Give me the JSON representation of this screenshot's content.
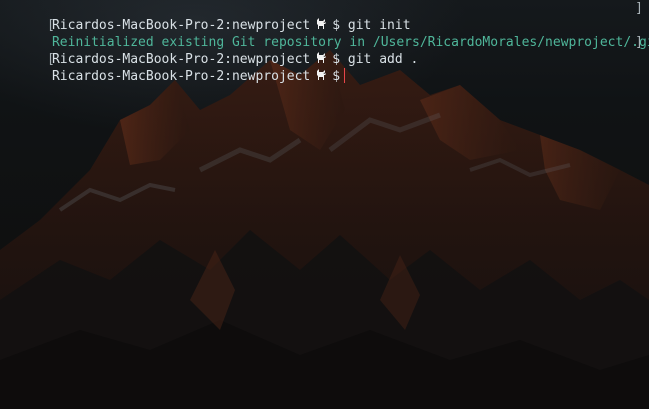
{
  "terminal": {
    "prompt_host": "Ricardos-MacBook-Pro-2:newproject",
    "prompt_symbol": "$",
    "prompt_icon": "goat-icon",
    "lines": [
      {
        "type": "command",
        "command": "git init"
      },
      {
        "type": "output",
        "text": "Reinitialized existing Git repository in /Users/RicardoMorales/newproject/.git/"
      },
      {
        "type": "command",
        "command": "git add ."
      },
      {
        "type": "command",
        "command": ""
      }
    ],
    "left_mark": "[",
    "right_mark": "]"
  },
  "colors": {
    "prompt_text": "#d9e1e6",
    "output_text": "#4fb69a",
    "cursor": "#e8464a"
  }
}
